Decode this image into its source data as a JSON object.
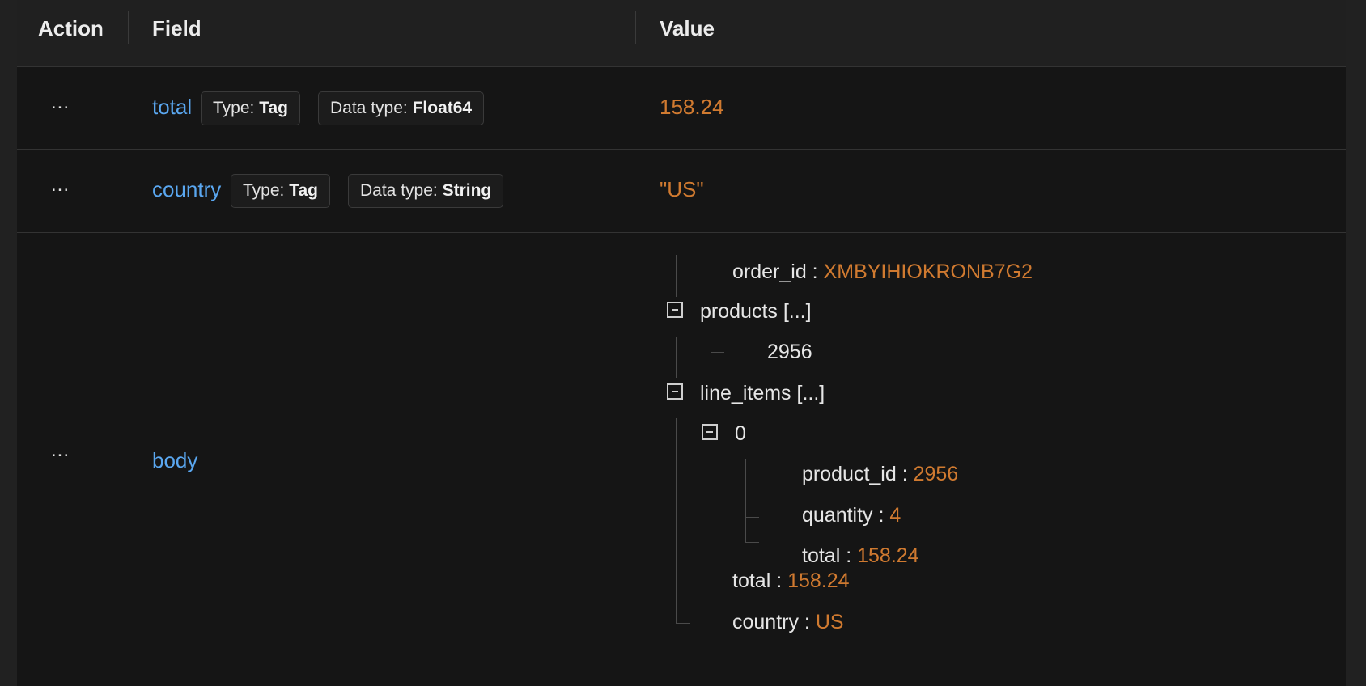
{
  "header": {
    "action": "Action",
    "field": "Field",
    "value": "Value"
  },
  "rows": [
    {
      "action": "...",
      "field": "total",
      "type_label": "Type:",
      "type_value": "Tag",
      "dtype_label": "Data type:",
      "dtype_value": "Float64",
      "value": "158.24"
    },
    {
      "action": "...",
      "field": "country",
      "type_label": "Type:",
      "type_value": "Tag",
      "dtype_label": "Data type:",
      "dtype_value": "String",
      "value": "\"US\""
    },
    {
      "action": "...",
      "field": "body",
      "tree": {
        "order_id": {
          "key": "order_id",
          "sep": " : ",
          "value": "XMBYIHIOKRONB7G2"
        },
        "products": {
          "key": "products [...]",
          "items": [
            "2956"
          ]
        },
        "line_items": {
          "key": "line_items [...]",
          "item0": {
            "key": "0",
            "product_id": {
              "key": "product_id",
              "sep": " : ",
              "value": "2956"
            },
            "quantity": {
              "key": "quantity",
              "sep": " : ",
              "value": "4"
            },
            "total": {
              "key": "total",
              "sep": " : ",
              "value": "158.24"
            }
          }
        },
        "total": {
          "key": "total",
          "sep": " : ",
          "value": "158.24"
        },
        "country": {
          "key": "country",
          "sep": " : ",
          "value": "US"
        }
      }
    }
  ],
  "colors": {
    "field_link": "#5aa7f0",
    "value": "#d07a30",
    "background": "#151515",
    "header_bg": "#202020"
  }
}
